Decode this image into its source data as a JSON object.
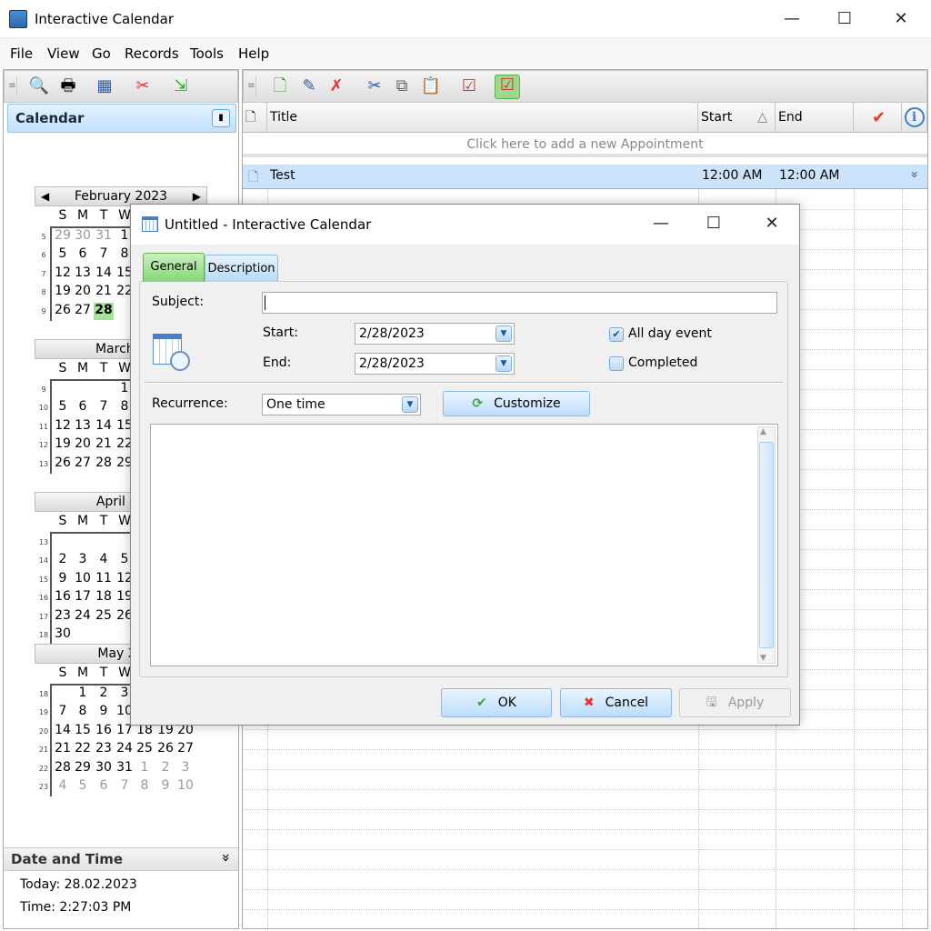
{
  "window": {
    "title": "Interactive Calendar",
    "minimize": "—",
    "maximize": "☐",
    "close": "✕"
  },
  "menu": [
    "File",
    "View",
    "Go",
    "Records",
    "Tools",
    "Help"
  ],
  "left_toolbar": {
    "icons": [
      "find-icon",
      "print-icon",
      "calendar-view-icon",
      "tools-icon",
      "import-icon"
    ]
  },
  "right_toolbar": {
    "icons": [
      "new-appointment-icon",
      "edit-appointment-icon",
      "delete-appointment-icon",
      "cut-icon",
      "copy-icon",
      "paste-icon",
      "tasks-icon",
      "active-tasks-icon"
    ]
  },
  "calendar_panel": {
    "title": "Calendar",
    "pin": "📌"
  },
  "calendar": {
    "dow": [
      "S",
      "M",
      "T",
      "W",
      "T",
      "F",
      "S"
    ],
    "months": [
      {
        "title": "February 2023",
        "prev": "◀",
        "next": "▶",
        "weeks": [
          {
            "n": "5",
            "days": [
              "29",
              "30",
              "31",
              "1"
            ],
            "gray": [
              0,
              1,
              2
            ]
          },
          {
            "n": "6",
            "days": [
              "5",
              "6",
              "7",
              "8"
            ]
          },
          {
            "n": "7",
            "days": [
              "12",
              "13",
              "14",
              "15"
            ]
          },
          {
            "n": "8",
            "days": [
              "19",
              "20",
              "21",
              "22"
            ]
          },
          {
            "n": "9",
            "days": [
              "26",
              "27",
              "28"
            ],
            "today": 2
          }
        ]
      },
      {
        "title": "March 2",
        "weeks": [
          {
            "n": "9",
            "days": [
              "",
              "",
              "",
              "1"
            ]
          },
          {
            "n": "10",
            "days": [
              "5",
              "6",
              "7",
              "8"
            ]
          },
          {
            "n": "11",
            "days": [
              "12",
              "13",
              "14",
              "15"
            ]
          },
          {
            "n": "12",
            "days": [
              "19",
              "20",
              "21",
              "22"
            ]
          },
          {
            "n": "13",
            "days": [
              "26",
              "27",
              "28",
              "29"
            ]
          }
        ]
      },
      {
        "title": "April 20",
        "weeks": [
          {
            "n": "13",
            "days": []
          },
          {
            "n": "14",
            "days": [
              "2",
              "3",
              "4",
              "5"
            ]
          },
          {
            "n": "15",
            "days": [
              "9",
              "10",
              "11",
              "12"
            ]
          },
          {
            "n": "16",
            "days": [
              "16",
              "17",
              "18",
              "19"
            ]
          },
          {
            "n": "17",
            "days": [
              "23",
              "24",
              "25",
              "26"
            ]
          },
          {
            "n": "18",
            "days": [
              "30"
            ]
          }
        ]
      },
      {
        "title": "May 20",
        "weeks": [
          {
            "n": "18",
            "days": [
              "",
              "1",
              "2",
              "3"
            ]
          },
          {
            "n": "19",
            "days": [
              "7",
              "8",
              "9",
              "10"
            ]
          },
          {
            "n": "20",
            "days": [
              "14",
              "15",
              "16",
              "17",
              "18",
              "19",
              "20"
            ]
          },
          {
            "n": "21",
            "days": [
              "21",
              "22",
              "23",
              "24",
              "25",
              "26",
              "27"
            ]
          },
          {
            "n": "22",
            "days": [
              "28",
              "29",
              "30",
              "31",
              "1",
              "2",
              "3"
            ],
            "gray": [
              4,
              5,
              6
            ]
          },
          {
            "n": "23",
            "days": [
              "4",
              "5",
              "6",
              "7",
              "8",
              "9",
              "10"
            ],
            "gray": [
              0,
              1,
              2,
              3,
              4,
              5,
              6
            ]
          }
        ]
      }
    ]
  },
  "datetime_panel": {
    "title": "Date and Time",
    "collapse": "»",
    "today": "Today: 28.02.2023",
    "time": "Time: 2:27:03 PM"
  },
  "grid": {
    "columns": {
      "title": "Title",
      "start": "Start",
      "end": "End",
      "sort": "△",
      "done_icon": "✔",
      "info_icon": "i"
    },
    "new_row": "Click here to add a new Appointment",
    "rows": [
      {
        "title": "Test",
        "start": "12:00 AM",
        "end": "12:00 AM",
        "expand": "»"
      }
    ]
  },
  "dialog": {
    "title": "Untitled - Interactive Calendar",
    "tabs": [
      "General",
      "Description"
    ],
    "subject_label": "Subject:",
    "subject_value": "",
    "start_label": "Start:",
    "start_value": "2/28/2023",
    "end_label": "End:",
    "end_value": "2/28/2023",
    "all_day_label": "All day event",
    "all_day_checked": true,
    "completed_label": "Completed",
    "completed_checked": false,
    "recurrence_label": "Recurrence:",
    "recurrence_value": "One time",
    "customize_label": "Customize",
    "ok_label": "OK",
    "cancel_label": "Cancel",
    "apply_label": "Apply"
  },
  "colors": {
    "accent_blue": "#bfe0ff",
    "today_green": "#a6e29a",
    "selected_row": "#cce4fb",
    "check_red": "#e8392a"
  }
}
